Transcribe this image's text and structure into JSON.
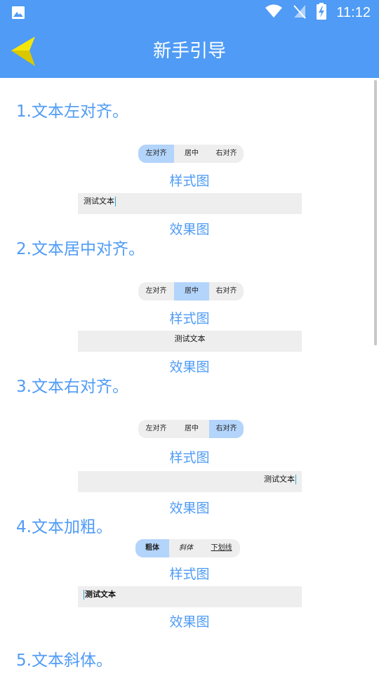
{
  "status_bar": {
    "time": "11:12"
  },
  "app_bar": {
    "title": "新手引导"
  },
  "sections": [
    {
      "title": "1.文本左对齐。",
      "segments": [
        "左对齐",
        "居中",
        "右对齐"
      ],
      "active": 0,
      "caption_style": "样式图",
      "preview_text": "测试文本",
      "caption_effect": "效果图"
    },
    {
      "title": "2.文本居中对齐。",
      "segments": [
        "左对齐",
        "居中",
        "右对齐"
      ],
      "active": 1,
      "caption_style": "样式图",
      "preview_text": "测试文本",
      "caption_effect": "效果图"
    },
    {
      "title": "3.文本右对齐。",
      "segments": [
        "左对齐",
        "居中",
        "右对齐"
      ],
      "active": 2,
      "caption_style": "样式图",
      "preview_text": "测试文本",
      "caption_effect": "效果图"
    },
    {
      "title": "4.文本加粗。",
      "segments": [
        "粗体",
        "斜体",
        "下划线"
      ],
      "active": 0,
      "caption_style": "样式图",
      "preview_text": "测试文本",
      "caption_effect": "效果图"
    },
    {
      "title": "5.文本斜体。"
    }
  ],
  "colors": {
    "accent": "#4f9bf5",
    "segment_active": "#b3d4fb",
    "preview_bg": "#eeeeee",
    "back_arrow": "#f5e60a"
  },
  "icons": {
    "status_left": "image-icon",
    "wifi": "wifi-icon",
    "signal": "no-signal-icon",
    "battery": "battery-charging-icon",
    "back": "back-arrow-icon"
  }
}
